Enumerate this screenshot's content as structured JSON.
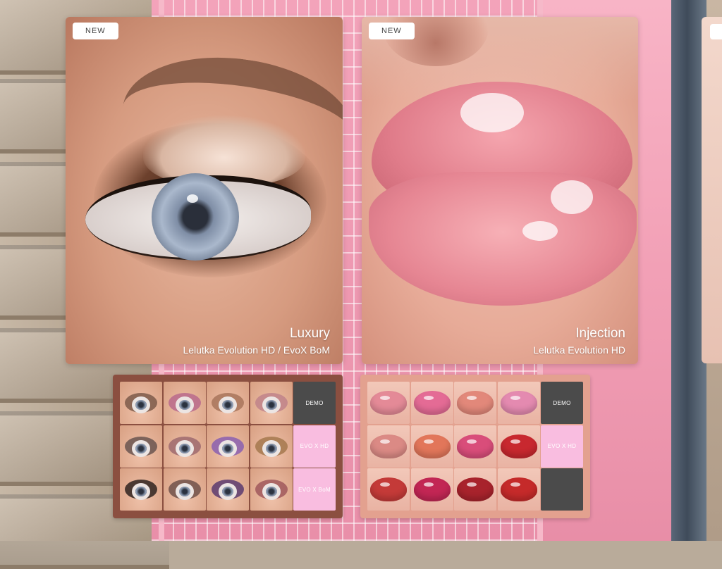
{
  "posters": [
    {
      "badge": "NEW",
      "title": "Luxury",
      "subtitle": "Lelutka Evolution HD / EvoX BoM"
    },
    {
      "badge": "NEW",
      "title": "Injection",
      "subtitle": "Lelutka Evolution HD"
    }
  ],
  "eye_board": {
    "buttons": [
      "DEMO",
      "EVO X HD",
      "EVO X BoM"
    ],
    "swatch_colors": [
      [
        "#7d5a4a",
        "#b86a8c",
        "#a8745a",
        "#c0828a"
      ],
      [
        "#6a5550",
        "#9e6a6e",
        "#8a5fb0",
        "#a4784e"
      ],
      [
        "#2f2320",
        "#70514a",
        "#5a3a6e",
        "#a0585c"
      ]
    ]
  },
  "lips_board": {
    "buttons": [
      "DEMO",
      "EVO X HD"
    ],
    "swatch_colors": [
      [
        "#e48a97",
        "#e46b95",
        "#e2887a",
        "#e48ab0"
      ],
      [
        "#db8a85",
        "#e2765a",
        "#d94d7a",
        "#c8282f"
      ],
      [
        "#c43a38",
        "#c22654",
        "#a8232c",
        "#c52a2a"
      ]
    ]
  }
}
